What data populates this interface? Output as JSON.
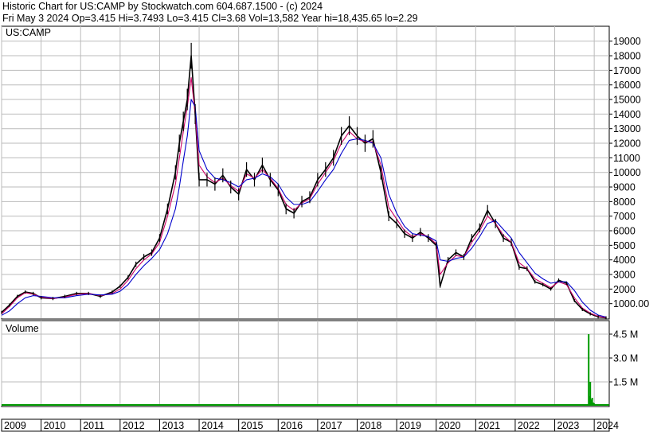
{
  "header": {
    "title_line": "Historic Chart for US:CAMP by Stockwatch.com 604.687.1500 - (c) 2024",
    "quote_line": "Fri May  3 2024  Op=3.415  Hi=3.7493  Lo=3.415  Cl=3.68  Vol=13,582  Year hi=18,435.65  lo=2.29"
  },
  "colors": {
    "price": "#000000",
    "short_ma": "#cc0066",
    "long_ma": "#0000cc",
    "volume": "#009900",
    "grid": "#bbbbbb"
  },
  "chart_data": [
    {
      "type": "line",
      "panel": "price",
      "title": "US:CAMP",
      "y_ticks": [
        "19000",
        "18000",
        "17000",
        "16000",
        "15000",
        "14000",
        "13000",
        "12000",
        "11000",
        "10000",
        "9000",
        "8000",
        "7000",
        "6000",
        "5000",
        "4000",
        "3000",
        "2000",
        "1000.00"
      ],
      "ylim": [
        0,
        19500
      ],
      "grid": true,
      "x_ticks": [
        "2009",
        "2010",
        "2011",
        "2012",
        "2013",
        "2014",
        "2015",
        "2016",
        "2017",
        "2018",
        "2019",
        "2020",
        "2021",
        "2022",
        "2023",
        "2024"
      ],
      "x": [
        2009.0,
        2009.2,
        2009.4,
        2009.6,
        2009.8,
        2010.0,
        2010.3,
        2010.6,
        2010.9,
        2011.2,
        2011.5,
        2011.8,
        2012.0,
        2012.2,
        2012.4,
        2012.6,
        2012.8,
        2013.0,
        2013.2,
        2013.4,
        2013.5,
        2013.6,
        2013.7,
        2013.8,
        2013.9,
        2014.0,
        2014.2,
        2014.4,
        2014.6,
        2014.8,
        2015.0,
        2015.2,
        2015.4,
        2015.6,
        2015.8,
        2016.0,
        2016.2,
        2016.4,
        2016.6,
        2016.8,
        2017.0,
        2017.2,
        2017.4,
        2017.6,
        2017.8,
        2018.0,
        2018.2,
        2018.4,
        2018.6,
        2018.8,
        2019.0,
        2019.2,
        2019.4,
        2019.6,
        2019.8,
        2020.0,
        2020.1,
        2020.3,
        2020.5,
        2020.7,
        2020.9,
        2021.1,
        2021.3,
        2021.5,
        2021.7,
        2021.9,
        2022.1,
        2022.3,
        2022.5,
        2022.7,
        2022.9,
        2023.1,
        2023.3,
        2023.5,
        2023.7,
        2023.9,
        2024.1,
        2024.3
      ],
      "series": [
        {
          "values": [
            400,
            900,
            1500,
            1800,
            1700,
            1400,
            1350,
            1500,
            1700,
            1700,
            1500,
            1800,
            2200,
            2800,
            3700,
            4200,
            4500,
            5500,
            7500,
            10000,
            12000,
            13500,
            15000,
            18000,
            14000,
            9500,
            9500,
            9200,
            9800,
            9000,
            8500,
            10200,
            9500,
            10500,
            9500,
            8800,
            7500,
            7200,
            8000,
            8300,
            9500,
            10200,
            11000,
            12500,
            13200,
            12500,
            12000,
            12300,
            10000,
            7000,
            6500,
            5800,
            5500,
            5900,
            5500,
            5000,
            2200,
            4000,
            4500,
            4200,
            5500,
            6200,
            7400,
            6500,
            5500,
            5200,
            3500,
            3400,
            2500,
            2300,
            2000,
            2600,
            2400,
            1200,
            600,
            300,
            100,
            20
          ]
        },
        {
          "values": [
            300,
            800,
            1400,
            1750,
            1650,
            1450,
            1350,
            1450,
            1650,
            1700,
            1550,
            1700,
            2000,
            2600,
            3400,
            4000,
            4400,
            5200,
            7000,
            9200,
            11000,
            12800,
            14500,
            16500,
            14000,
            10500,
            9700,
            9300,
            9600,
            9100,
            8700,
            9900,
            9600,
            10200,
            9600,
            8900,
            7800,
            7400,
            7900,
            8200,
            9200,
            10000,
            10800,
            12000,
            12800,
            12300,
            12100,
            12100,
            10500,
            7600,
            6800,
            6000,
            5600,
            5800,
            5600,
            5100,
            3000,
            3800,
            4300,
            4200,
            5200,
            6000,
            7000,
            6500,
            5700,
            5200,
            3800,
            3400,
            2700,
            2400,
            2100,
            2500,
            2300,
            1400,
            700,
            350,
            130,
            40
          ]
        },
        {
          "values": [
            200,
            500,
            1000,
            1400,
            1550,
            1500,
            1400,
            1400,
            1550,
            1650,
            1600,
            1650,
            1850,
            2300,
            3000,
            3600,
            4100,
            4700,
            5800,
            7500,
            9000,
            10800,
            12500,
            15000,
            14500,
            11500,
            10200,
            9600,
            9500,
            9300,
            9000,
            9500,
            9600,
            9900,
            9700,
            9200,
            8300,
            7800,
            7800,
            8000,
            8700,
            9500,
            10200,
            11300,
            12200,
            12300,
            12200,
            12000,
            11000,
            8500,
            7200,
            6300,
            5800,
            5700,
            5600,
            5300,
            4000,
            3900,
            4100,
            4200,
            4800,
            5600,
            6500,
            6700,
            6100,
            5500,
            4500,
            3800,
            3100,
            2700,
            2400,
            2500,
            2500,
            1900,
            1100,
            550,
            220,
            80
          ]
        }
      ]
    },
    {
      "type": "bar",
      "panel": "volume",
      "title": "Volume",
      "y_ticks": [
        "4.5 M",
        "3.0 M",
        "1.5 M"
      ],
      "ylim": [
        0,
        5000000
      ],
      "x": [
        2023.86,
        2023.88,
        2023.9,
        2023.93,
        2023.95,
        2023.98,
        2024.0,
        2024.1
      ],
      "values": [
        4500000,
        600000,
        1500000,
        400000,
        500000,
        200000,
        150000,
        50000
      ]
    }
  ]
}
